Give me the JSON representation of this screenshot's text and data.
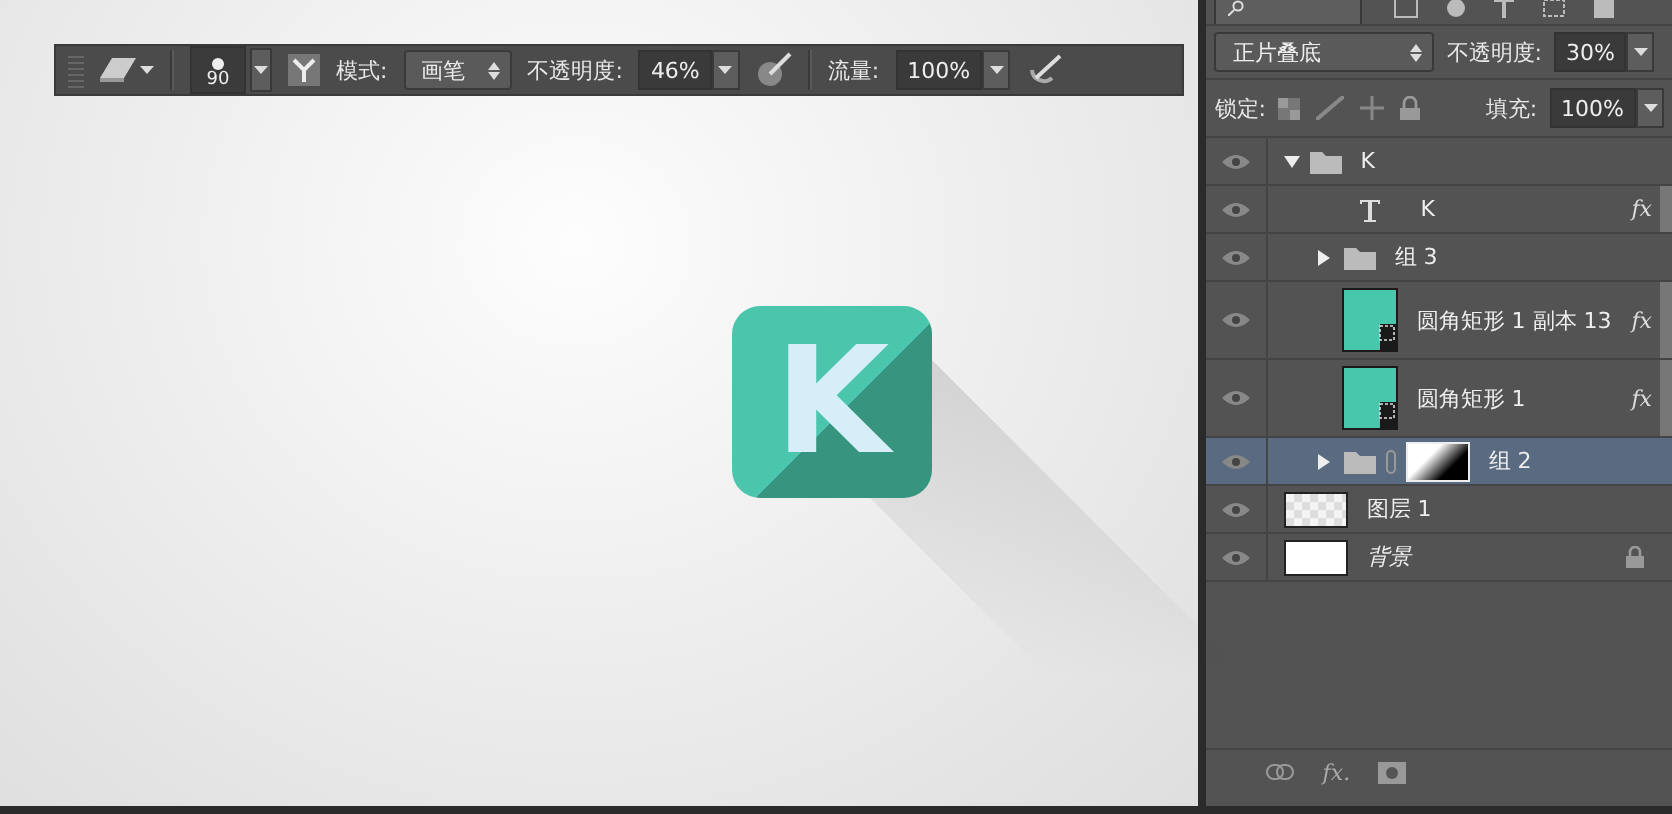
{
  "options_bar": {
    "brush_size": "90",
    "mode_label": "模式:",
    "mode": "画笔",
    "opacity_label": "不透明度:",
    "opacity": "46%",
    "flow_label": "流量:",
    "flow": "100%"
  },
  "canvas": {
    "icon_letter": "K"
  },
  "layers_panel": {
    "blend_mode": "正片叠底",
    "opacity_label": "不透明度:",
    "opacity": "30%",
    "lock_label": "锁定:",
    "fill_label": "填充:",
    "fill": "100%",
    "layers": [
      {
        "kind": "group",
        "name": "K",
        "visible": true,
        "selected": false,
        "expanded": true,
        "children": [
          {
            "kind": "text",
            "name": "K",
            "visible": true,
            "selected": false,
            "effect": "fx"
          },
          {
            "kind": "group",
            "name": "组 3",
            "visible": true,
            "selected": false,
            "expanded": false
          },
          {
            "kind": "shape",
            "name": "圆角矩形 1 副本 13",
            "visible": true,
            "selected": false,
            "effect": "fx"
          },
          {
            "kind": "shape",
            "name": "圆角矩形 1",
            "visible": true,
            "selected": false,
            "effect": "fx"
          },
          {
            "kind": "group",
            "name": "组 2",
            "visible": true,
            "selected": true,
            "expanded": false,
            "mask": true
          }
        ]
      },
      {
        "kind": "pixel",
        "name": "图层 1",
        "visible": true,
        "selected": false
      },
      {
        "kind": "background",
        "name": "背景",
        "visible": true,
        "selected": false,
        "locked": true
      }
    ],
    "footer_fx": "fx."
  }
}
